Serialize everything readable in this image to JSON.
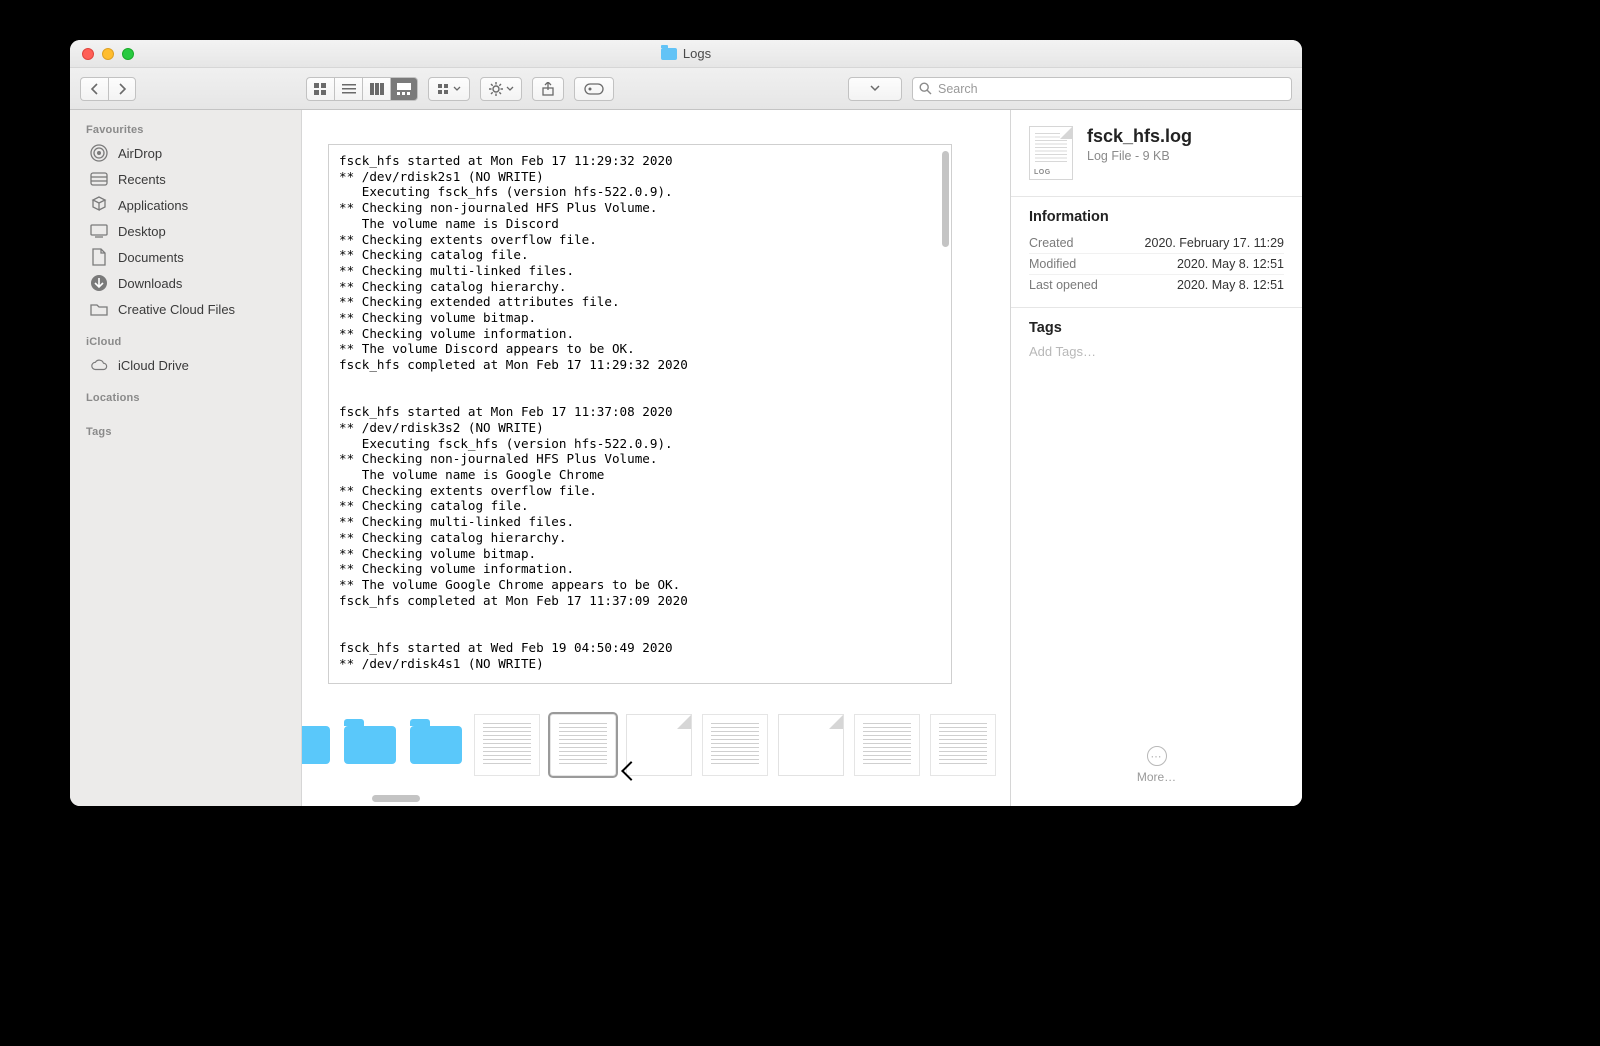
{
  "window": {
    "title": "Logs"
  },
  "toolbar": {
    "search_placeholder": "Search"
  },
  "sidebar": {
    "sections": {
      "favourites": {
        "header": "Favourites",
        "items": [
          "AirDrop",
          "Recents",
          "Applications",
          "Desktop",
          "Documents",
          "Downloads",
          "Creative Cloud Files"
        ]
      },
      "icloud": {
        "header": "iCloud",
        "items": [
          "iCloud Drive"
        ]
      },
      "locations": {
        "header": "Locations"
      },
      "tags": {
        "header": "Tags"
      }
    }
  },
  "preview": {
    "content": "fsck_hfs started at Mon Feb 17 11:29:32 2020\n** /dev/rdisk2s1 (NO WRITE)\n   Executing fsck_hfs (version hfs-522.0.9).\n** Checking non-journaled HFS Plus Volume.\n   The volume name is Discord\n** Checking extents overflow file.\n** Checking catalog file.\n** Checking multi-linked files.\n** Checking catalog hierarchy.\n** Checking extended attributes file.\n** Checking volume bitmap.\n** Checking volume information.\n** The volume Discord appears to be OK.\nfsck_hfs completed at Mon Feb 17 11:29:32 2020\n\n\nfsck_hfs started at Mon Feb 17 11:37:08 2020\n** /dev/rdisk3s2 (NO WRITE)\n   Executing fsck_hfs (version hfs-522.0.9).\n** Checking non-journaled HFS Plus Volume.\n   The volume name is Google Chrome\n** Checking extents overflow file.\n** Checking catalog file.\n** Checking multi-linked files.\n** Checking catalog hierarchy.\n** Checking volume bitmap.\n** Checking volume information.\n** The volume Google Chrome appears to be OK.\nfsck_hfs completed at Mon Feb 17 11:37:09 2020\n\n\nfsck_hfs started at Wed Feb 19 04:50:49 2020\n** /dev/rdisk4s1 (NO WRITE)"
  },
  "inspector": {
    "filename": "fsck_hfs.log",
    "kind_size": "Log File - 9 KB",
    "file_icon_tag": "LOG",
    "info_header": "Information",
    "info": {
      "created_label": "Created",
      "created_value": "2020. February 17. 11:29",
      "modified_label": "Modified",
      "modified_value": "2020. May 8. 12:51",
      "opened_label": "Last opened",
      "opened_value": "2020. May 8. 12:51"
    },
    "tags_header": "Tags",
    "add_tags": "Add Tags…",
    "more": "More…"
  }
}
